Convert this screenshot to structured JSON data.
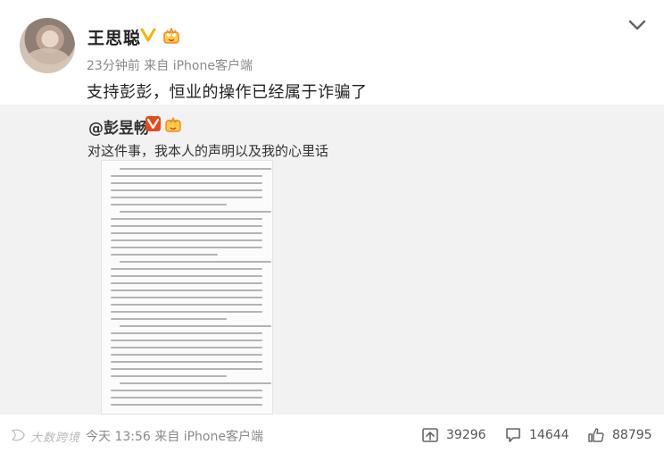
{
  "post": {
    "author": "王思聪",
    "meta": "23分钟前 来自 iPhone客户端",
    "text": "支持彭彭，恒业的操作已经属于诈骗了"
  },
  "repost": {
    "author": "@彭昱畅",
    "text": "对这件事，我本人的声明以及我的心里话"
  },
  "footer": {
    "meta": "今天 13:56 来自 iPhone客户端",
    "reposts": "39296",
    "comments": "14644",
    "likes": "88795"
  },
  "watermark": "大数跨境",
  "colors": {
    "verified": "#f4b400",
    "link": "#333333",
    "text": "#222222",
    "secondary": "#8a8a8a",
    "card_background": "#f2f2f2"
  }
}
